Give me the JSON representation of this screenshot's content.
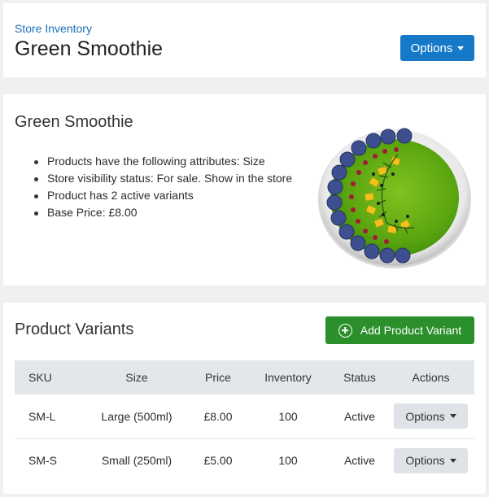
{
  "header": {
    "breadcrumb": "Store Inventory",
    "title": "Green Smoothie",
    "options_label": "Options"
  },
  "product": {
    "name": "Green Smoothie",
    "attributes": [
      "Products have the following attributes: Size",
      "Store visibility status: For sale. Show in the store",
      "Product has 2 active variants",
      "Base Price: £8.00"
    ],
    "image_icon": "green-smoothie-bowl-image"
  },
  "variants": {
    "title": "Product Variants",
    "add_label": "Add Product Variant",
    "columns": [
      "SKU",
      "Size",
      "Price",
      "Inventory",
      "Status",
      "Actions"
    ],
    "rows": [
      {
        "sku": "SM-L",
        "size": "Large (500ml)",
        "price": "£8.00",
        "inventory": "100",
        "status": "Active",
        "action": "Options"
      },
      {
        "sku": "SM-S",
        "size": "Small (250ml)",
        "price": "£5.00",
        "inventory": "100",
        "status": "Active",
        "action": "Options"
      }
    ]
  },
  "colors": {
    "primary": "#1679c8",
    "success": "#2b8f2b",
    "status_active": "#2e8b2e",
    "background": "#eef0f2"
  }
}
